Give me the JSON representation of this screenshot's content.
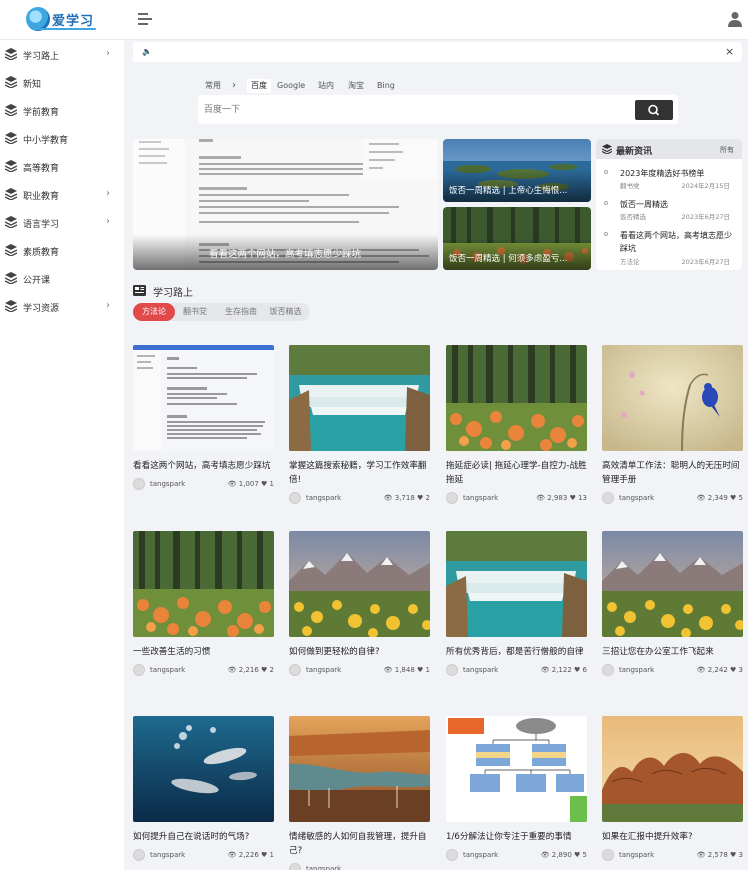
{
  "logo": {
    "text": "爱学习"
  },
  "sidebar": {
    "items": [
      {
        "label": "学习路上",
        "has_children": true
      },
      {
        "label": "新知",
        "has_children": false
      },
      {
        "label": "学前教育",
        "has_children": false
      },
      {
        "label": "中小学教育",
        "has_children": false
      },
      {
        "label": "高等教育",
        "has_children": false
      },
      {
        "label": "职业教育",
        "has_children": true
      },
      {
        "label": "语言学习",
        "has_children": true
      },
      {
        "label": "素质教育",
        "has_children": false
      },
      {
        "label": "公开课",
        "has_children": false
      },
      {
        "label": "学习资源",
        "has_children": true
      }
    ]
  },
  "notice": {
    "close": "×"
  },
  "search": {
    "tabs": [
      {
        "label": "常用",
        "active": false
      },
      {
        "label": "百度",
        "active": true
      },
      {
        "label": "Google",
        "active": false
      },
      {
        "label": "站内",
        "active": false
      },
      {
        "label": "淘宝",
        "active": false
      },
      {
        "label": "Bing",
        "active": false
      }
    ],
    "placeholder": "百度一下"
  },
  "slider": {
    "caption": "看看这两个网站，高考填志愿少踩坑"
  },
  "tiles": [
    {
      "caption": "饭否一周精选 | 上帝心生悔恨..."
    },
    {
      "caption": "饭否一周精选 | 何须多虑盈亏..."
    }
  ],
  "news": {
    "title": "最新资讯",
    "more": "所有",
    "items": [
      {
        "title": "2023年度精选好书榜单",
        "category": "翻书党",
        "date": "2024年2月15日"
      },
      {
        "title": "饭否一周精选",
        "category": "饭否精选",
        "date": "2023年6月27日"
      },
      {
        "title": "看看这两个网站，高考填志愿少踩坑",
        "category": "方法论",
        "date": "2023年6月27日"
      }
    ]
  },
  "section": {
    "title": "学习路上",
    "tabs": [
      {
        "label": "方法论",
        "active": true
      },
      {
        "label": "翻书党",
        "active": false
      },
      {
        "label": "生存指南",
        "active": false
      },
      {
        "label": "饭否精选",
        "active": false
      }
    ]
  },
  "cards": [
    {
      "title": "看看这两个网站，高考填志愿少踩坑",
      "author": "tangspark",
      "views": "1,007",
      "likes": "1",
      "image": "screenshot"
    },
    {
      "title": "掌握这篇搜索秘籍，学习工作效率翻倍!",
      "author": "tangspark",
      "views": "3,718",
      "likes": "2",
      "image": "waterfall"
    },
    {
      "title": "拖延症必读| 拖延心理学-自控力-战胜拖延",
      "author": "tangspark",
      "views": "2,983",
      "likes": "13",
      "image": "forest"
    },
    {
      "title": "高效清单工作法：聪明人的无压时间管理手册",
      "author": "tangspark",
      "views": "2,349",
      "likes": "5",
      "image": "bird"
    },
    {
      "title": "一些改善生活的习惯",
      "author": "tangspark",
      "views": "2,216",
      "likes": "2",
      "image": "forest"
    },
    {
      "title": "如何做到更轻松的自律?",
      "author": "tangspark",
      "views": "1,848",
      "likes": "1",
      "image": "mountain"
    },
    {
      "title": "所有优秀背后，都是苦行僧般的自律",
      "author": "tangspark",
      "views": "2,122",
      "likes": "6",
      "image": "waterfall"
    },
    {
      "title": "三招让您在办公室工作飞起来",
      "author": "tangspark",
      "views": "2,242",
      "likes": "3",
      "image": "mountain"
    },
    {
      "title": "如何提升自己在说话时的气场?",
      "author": "tangspark",
      "views": "2,226",
      "likes": "1",
      "image": "dolphin"
    },
    {
      "title": "情绪敏感的人如何自我管理，提升自己?",
      "author": "tangspark",
      "views": "",
      "likes": "",
      "image": "canyon"
    },
    {
      "title": "1/6分解法让你专注于重要的事情",
      "author": "tangspark",
      "views": "2,890",
      "likes": "5",
      "image": "diagram"
    },
    {
      "title": "如果在汇报中提升效率?",
      "author": "tangspark",
      "views": "2,578",
      "likes": "3",
      "image": "rocks"
    }
  ],
  "colors": {
    "accent": "#e24a4a",
    "brand": "#1f6fb8",
    "dark_button": "#333333"
  }
}
